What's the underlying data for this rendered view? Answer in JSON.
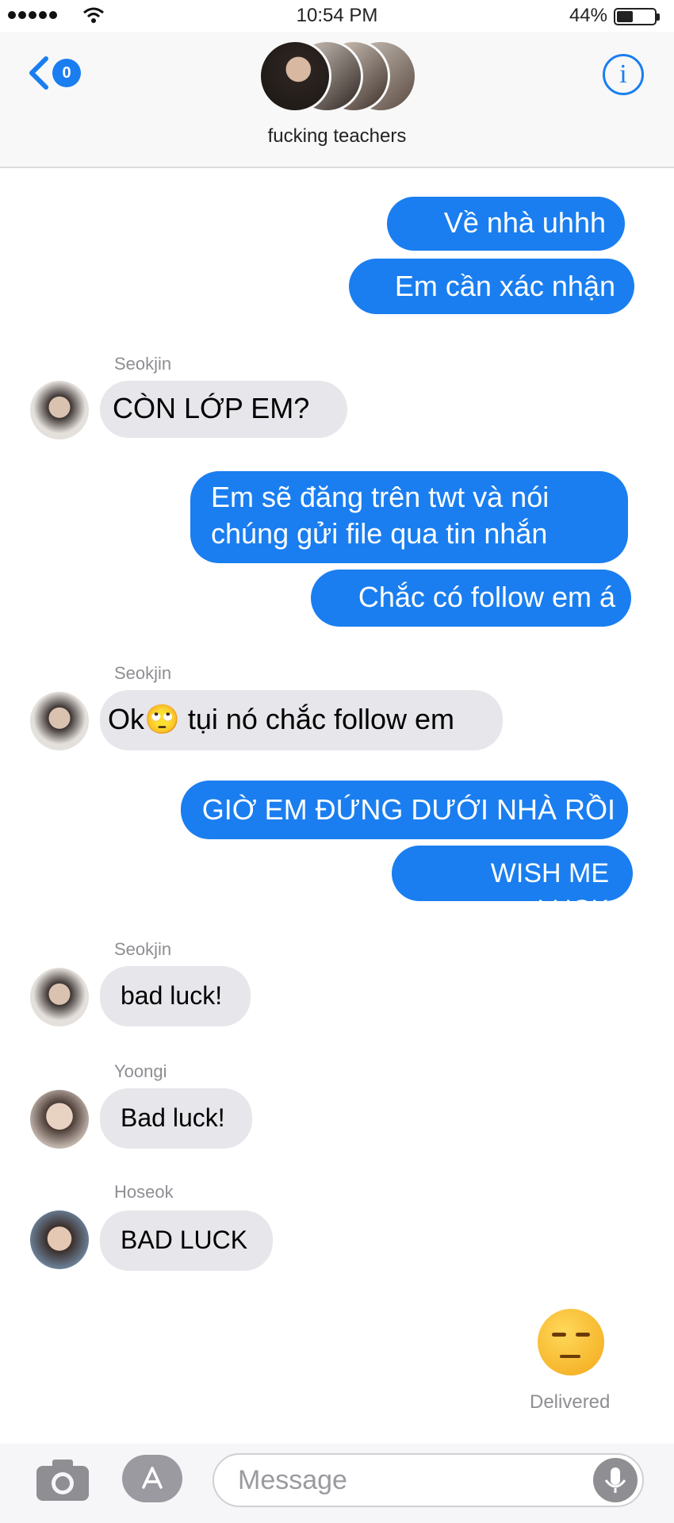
{
  "status_bar": {
    "time": "10:54 PM",
    "battery": "44%",
    "battery_level": 0.44
  },
  "header": {
    "back_count": "0",
    "group_name": "fucking teachers",
    "info_label": "i"
  },
  "messages": [
    {
      "type": "sent",
      "lines": [
        "Về nhà uhhh"
      ]
    },
    {
      "type": "sent",
      "lines": [
        "Em cần xác nhận"
      ]
    },
    {
      "type": "received",
      "sender": "Seokjin",
      "lines": [
        "CÒN LỚP EM?"
      ]
    },
    {
      "type": "sent",
      "lines": [
        "Em sẽ đăng trên twt và nói",
        "chúng gửi file qua tin nhắn"
      ]
    },
    {
      "type": "sent",
      "lines": [
        "Chắc có follow em á"
      ]
    },
    {
      "type": "received",
      "sender": "Seokjin",
      "lines": [
        "Ok🙄 tụi nó chắc follow em"
      ]
    },
    {
      "type": "sent",
      "lines": [
        "GIỜ EM ĐỨNG DƯỚI NHÀ RỒI"
      ]
    },
    {
      "type": "sent",
      "lines": [
        "WISH ME LUCK"
      ]
    },
    {
      "type": "received",
      "sender": "Seokjin",
      "lines": [
        "bad luck!"
      ]
    },
    {
      "type": "received",
      "sender": "Yoongi",
      "lines": [
        "Bad luck!"
      ]
    },
    {
      "type": "received",
      "sender": "Hoseok",
      "lines": [
        "BAD LUCK"
      ]
    }
  ],
  "last_sent_emoji": "unamused-face",
  "delivered_label": "Delivered",
  "input": {
    "placeholder": "Message"
  },
  "icons": {
    "back": "chevron-left-icon",
    "info": "info-icon",
    "camera": "camera-icon",
    "app_store": "app-store-icon",
    "microphone": "microphone-icon",
    "wifi": "wifi-icon",
    "battery": "battery-icon"
  },
  "colors": {
    "sent_bubble": "#1a7ef0",
    "received_bubble": "#e6e6eb",
    "accent": "#1a7ef0"
  }
}
